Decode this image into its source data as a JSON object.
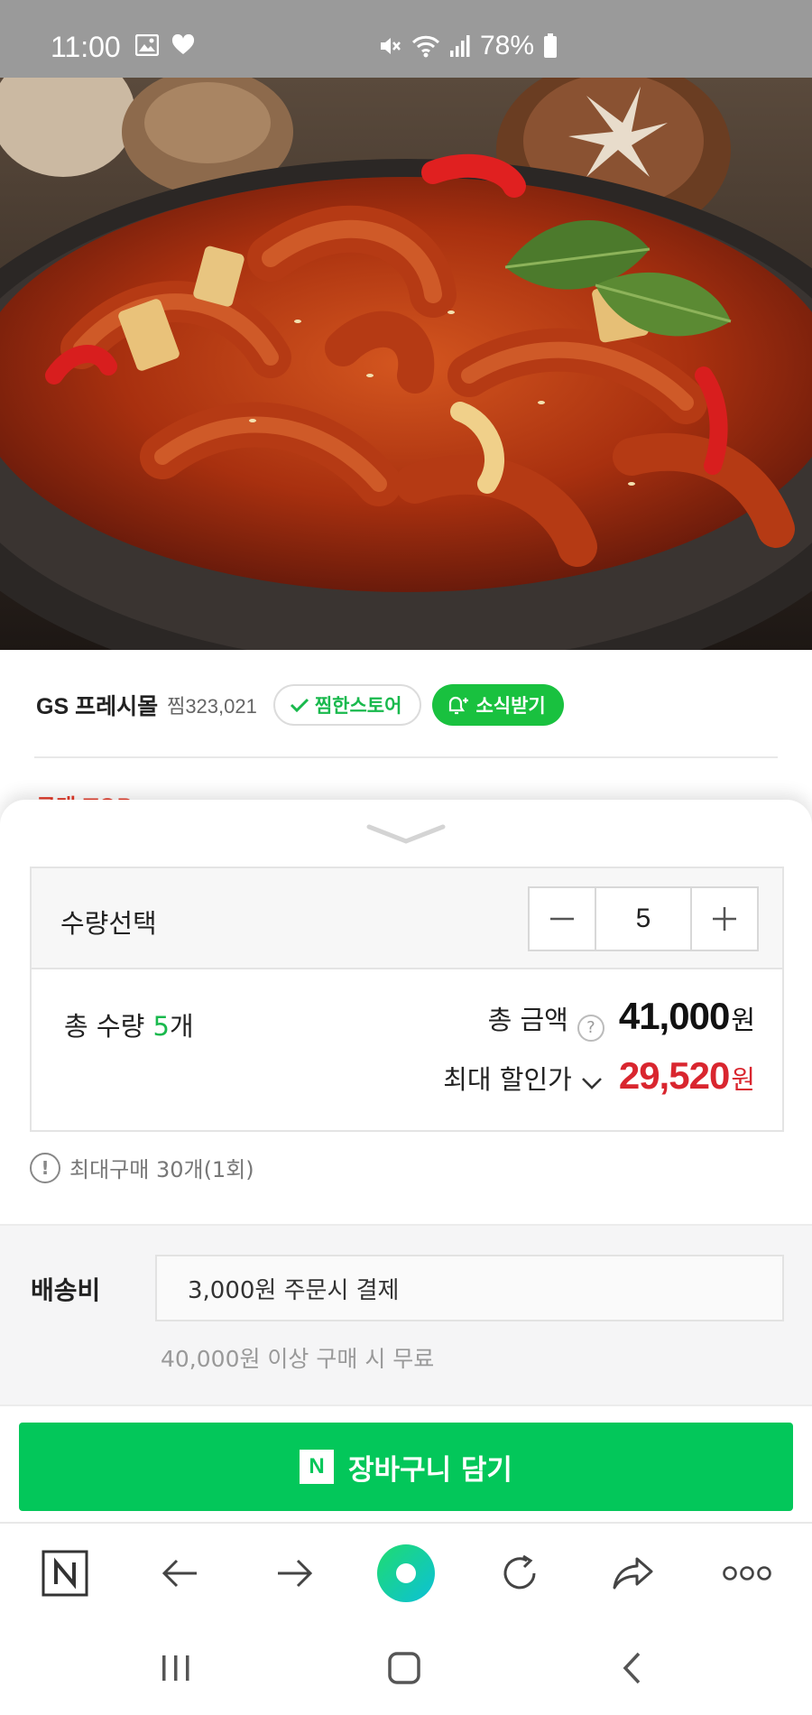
{
  "status_bar": {
    "time": "11:00",
    "battery": "78%"
  },
  "hero": {
    "description_icon": "product-photo-spicy-octopus"
  },
  "store": {
    "name": "GS 프레시몰",
    "jjim_count": "찜323,021",
    "jjim_button": "찜한스토어",
    "news_button": "소식받기"
  },
  "peek": {
    "text": "구매 TOP"
  },
  "quantity": {
    "label": "수량선택",
    "value": "5",
    "minus_icon": "minus-icon",
    "plus_icon": "plus-icon"
  },
  "totals": {
    "count_prefix": "총 수량 ",
    "count_value": "5",
    "count_suffix": "개",
    "total_label": "총 금액",
    "total_price": "41,000",
    "currency": "원",
    "discount_label": "최대 할인가",
    "discount_price": "29,520"
  },
  "notice": {
    "max_purchase": "최대구매 30개(1회)"
  },
  "shipping": {
    "label": "배송비",
    "option": "3,000원 주문시 결제",
    "free_note": "40,000원 이상 구매 시 무료"
  },
  "cart": {
    "badge": "N",
    "label": "장바구니 담기"
  },
  "colors": {
    "naver_green": "#03c75a",
    "price_red": "#d9262f",
    "accent_green": "#19b94d"
  }
}
